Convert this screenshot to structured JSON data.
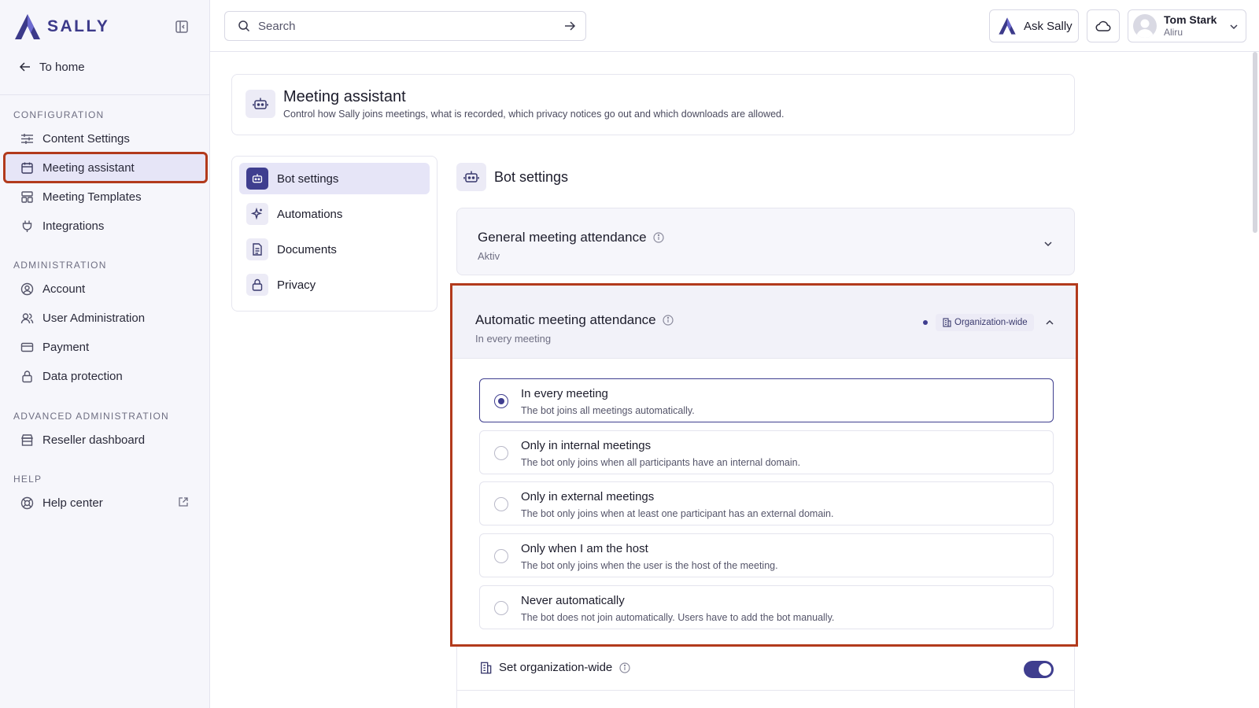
{
  "brand": {
    "name": "SALLY",
    "accent": "#3f3e8f",
    "highlight": "#b23a1c"
  },
  "sidebar": {
    "to_home": "To home",
    "sections": [
      {
        "label": "CONFIGURATION",
        "items": [
          "Content Settings",
          "Meeting assistant",
          "Meeting Templates",
          "Integrations"
        ]
      },
      {
        "label": "ADMINISTRATION",
        "items": [
          "Account",
          "User Administration",
          "Payment",
          "Data protection"
        ]
      },
      {
        "label": "ADVANCED ADMINISTRATION",
        "items": [
          "Reseller dashboard"
        ]
      },
      {
        "label": "HELP",
        "items": [
          "Help center"
        ]
      }
    ],
    "active_item": "Meeting assistant"
  },
  "topbar": {
    "search_placeholder": "Search",
    "ask_label": "Ask Sally",
    "user": {
      "name": "Tom Stark",
      "org": "Aliru"
    }
  },
  "header": {
    "title": "Meeting assistant",
    "subtitle": "Control how Sally joins meetings, what is recorded, which privacy notices go out and which downloads are allowed."
  },
  "submenu": {
    "items": [
      "Bot settings",
      "Automations",
      "Documents",
      "Privacy"
    ],
    "active": "Bot settings"
  },
  "main": {
    "title": "Bot settings",
    "general": {
      "title": "General meeting attendance",
      "status": "Aktiv"
    },
    "automatic": {
      "title": "Automatic meeting attendance",
      "status": "In every meeting",
      "badge": "Organization-wide",
      "options": [
        {
          "title": "In every meeting",
          "desc": "The bot joins all meetings automatically.",
          "selected": true
        },
        {
          "title": "Only in internal meetings",
          "desc": "The bot only joins when all participants have an internal domain.",
          "selected": false
        },
        {
          "title": "Only in external meetings",
          "desc": "The bot only joins when at least one participant has an external domain.",
          "selected": false
        },
        {
          "title": "Only when I am the host",
          "desc": "The bot only joins when the user is the host of the meeting.",
          "selected": false
        },
        {
          "title": "Never automatically",
          "desc": "The bot does not join automatically. Users have to add the bot manually.",
          "selected": false
        }
      ]
    },
    "org_wide": {
      "label": "Set organization-wide",
      "enabled": true
    }
  }
}
